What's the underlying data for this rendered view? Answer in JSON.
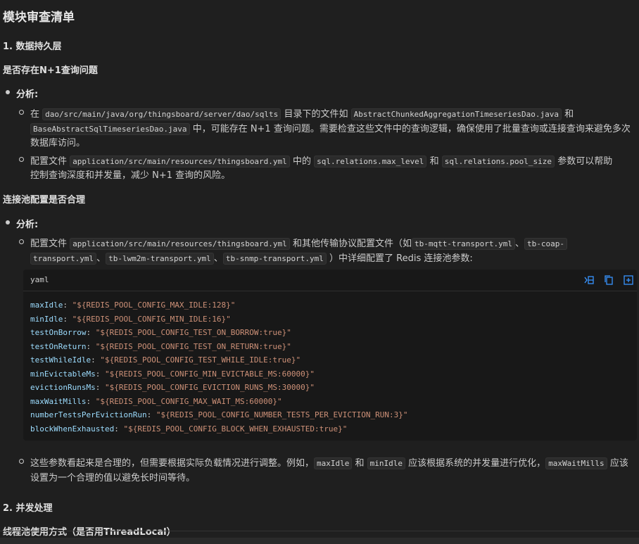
{
  "title": "模块审查清单",
  "section1": {
    "heading": "1. 数据持久层",
    "q1": "是否存在N+1查询问题",
    "analysis_label": "分析:",
    "item1": {
      "t1": "在",
      "c1": "dao/src/main/java/org/thingsboard/server/dao/sqlts",
      "t2": "目录下的文件如",
      "c2": "AbstractChunkedAggregationTimeseriesDao.java",
      "t3": "和",
      "c3": "BaseAbstractSqlTimeseriesDao.java",
      "t4": "中，可能存在 N+1 查询问题。需要检查这些文件中的查询逻辑，确保使用了批量查询或连接查询来避免多次",
      "t5": "数据库访问。"
    },
    "item2": {
      "t1": "配置文件",
      "c1": "application/src/main/resources/thingsboard.yml",
      "t2": "中的",
      "c2": "sql.relations.max_level",
      "t3": "和",
      "c3": "sql.relations.pool_size",
      "t4": "参数可以帮助",
      "t5": "控制查询深度和并发量，减少 N+1 查询的风险。"
    },
    "q2": "连接池配置是否合理",
    "analysis_label2": "分析:",
    "item3": {
      "t1": "配置文件",
      "c1": "application/src/main/resources/thingsboard.yml",
      "t2": "和其他传输协议配置文件（如",
      "c2": "tb-mqtt-transport.yml",
      "sep1": "、",
      "c3": "tb-coap-",
      "c4": "transport.yml",
      "sep2": "、",
      "c5": "tb-lwm2m-transport.yml",
      "sep3": "、",
      "c6": "tb-snmp-transport.yml",
      "t3": "）中详细配置了 Redis 连接池参数:"
    },
    "code": {
      "lang": "yaml",
      "icons": [
        "insert-icon",
        "copy-icon",
        "new-file-icon"
      ],
      "lines": [
        {
          "key": "maxIdle",
          "val": "\"${REDIS_POOL_CONFIG_MAX_IDLE:128}\""
        },
        {
          "key": "minIdle",
          "val": "\"${REDIS_POOL_CONFIG_MIN_IDLE:16}\""
        },
        {
          "key": "testOnBorrow",
          "val": "\"${REDIS_POOL_CONFIG_TEST_ON_BORROW:true}\""
        },
        {
          "key": "testOnReturn",
          "val": "\"${REDIS_POOL_CONFIG_TEST_ON_RETURN:true}\""
        },
        {
          "key": "testWhileIdle",
          "val": "\"${REDIS_POOL_CONFIG_TEST_WHILE_IDLE:true}\""
        },
        {
          "key": "minEvictableMs",
          "val": "\"${REDIS_POOL_CONFIG_MIN_EVICTABLE_MS:60000}\""
        },
        {
          "key": "evictionRunsMs",
          "val": "\"${REDIS_POOL_CONFIG_EVICTION_RUNS_MS:30000}\""
        },
        {
          "key": "maxWaitMills",
          "val": "\"${REDIS_POOL_CONFIG_MAX_WAIT_MS:60000}\""
        },
        {
          "key": "numberTestsPerEvictionRun",
          "val": "\"${REDIS_POOL_CONFIG_NUMBER_TESTS_PER_EVICTION_RUN:3}\""
        },
        {
          "key": "blockWhenExhausted",
          "val": "\"${REDIS_POOL_CONFIG_BLOCK_WHEN_EXHAUSTED:true}\""
        }
      ]
    },
    "item4": {
      "t1": "这些参数看起来是合理的，但需要根据实际负载情况进行调整。例如，",
      "c1": "maxIdle",
      "t2": "和",
      "c2": "minIdle",
      "t3": "应该根据系统的并发量进行优化，",
      "c3": "maxWaitMills",
      "t4": "应该",
      "t5": "设置为一个合理的值以避免长时间等待。"
    }
  },
  "section2": {
    "heading": "2. 并发处理",
    "q1": "线程池使用方式（是否用ThreadLocal）"
  },
  "colors": {
    "background": "#1f1f1f",
    "code_key": "#9cdcfe",
    "code_string": "#ce9178",
    "icon_blue": "#3794ff"
  }
}
